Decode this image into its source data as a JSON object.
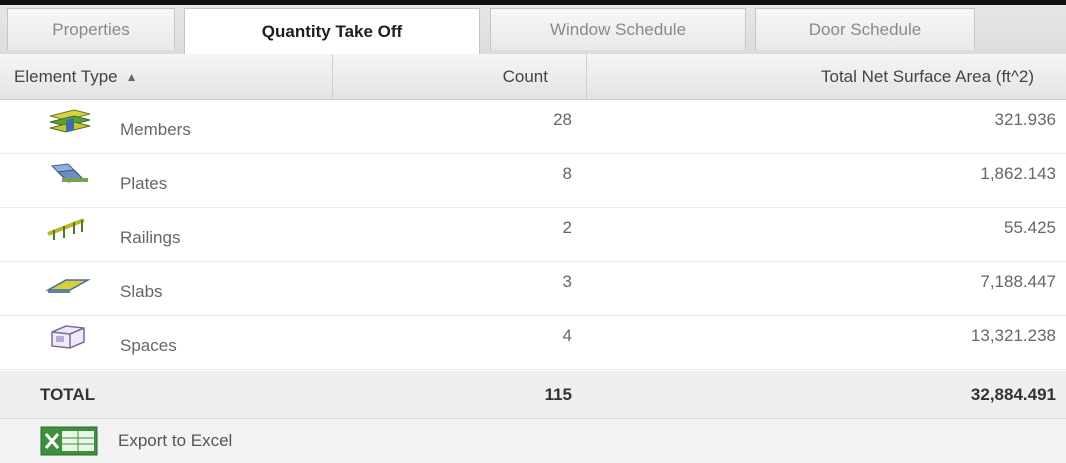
{
  "tabs": [
    {
      "label": "Properties",
      "active": false
    },
    {
      "label": "Quantity Take Off",
      "active": true
    },
    {
      "label": "Window Schedule",
      "active": false
    },
    {
      "label": "Door Schedule",
      "active": false
    }
  ],
  "table": {
    "columns": {
      "type": "Element Type",
      "type_sort": "▲",
      "count": "Count",
      "area": "Total Net Surface Area (ft^2)"
    },
    "rows": [
      {
        "icon": "members-icon",
        "label": "Members",
        "count": "28",
        "area": "321.936"
      },
      {
        "icon": "plates-icon",
        "label": "Plates",
        "count": "8",
        "area": "1,862.143"
      },
      {
        "icon": "railings-icon",
        "label": "Railings",
        "count": "2",
        "area": "55.425"
      },
      {
        "icon": "slabs-icon",
        "label": "Slabs",
        "count": "3",
        "area": "7,188.447"
      },
      {
        "icon": "spaces-icon",
        "label": "Spaces",
        "count": "4",
        "area": "13,321.238"
      }
    ],
    "total": {
      "label": "TOTAL",
      "count": "115",
      "area": "32,884.491"
    }
  },
  "footer": {
    "export_label": "Export to Excel",
    "export_icon": "excel-icon"
  },
  "colors": {
    "excel_green": "#3e8f3e",
    "header_bg": "#e8e8e8"
  }
}
